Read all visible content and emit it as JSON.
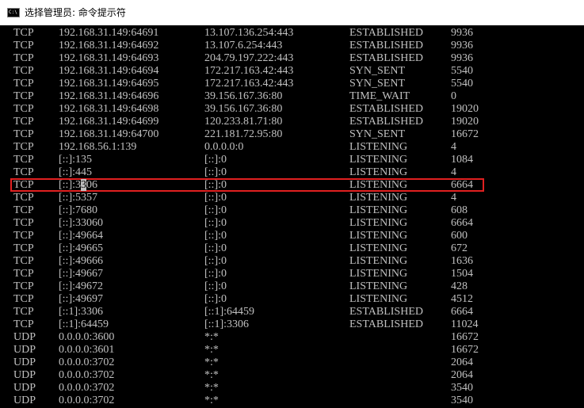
{
  "window": {
    "title": "选择管理员: 命令提示符",
    "icon": "cmd-icon",
    "icon_glyph": "C:\\"
  },
  "colors": {
    "console_bg": "#000000",
    "console_fg": "#c0c0c0",
    "highlight": "#e02020"
  },
  "netstat": {
    "rows": [
      {
        "proto": "TCP",
        "local": "192.168.31.149:64691",
        "foreign": "13.107.136.254:443",
        "state": "ESTABLISHED",
        "pid": "9936"
      },
      {
        "proto": "TCP",
        "local": "192.168.31.149:64692",
        "foreign": "13.107.6.254:443",
        "state": "ESTABLISHED",
        "pid": "9936"
      },
      {
        "proto": "TCP",
        "local": "192.168.31.149:64693",
        "foreign": "204.79.197.222:443",
        "state": "ESTABLISHED",
        "pid": "9936"
      },
      {
        "proto": "TCP",
        "local": "192.168.31.149:64694",
        "foreign": "172.217.163.42:443",
        "state": "SYN_SENT",
        "pid": "5540"
      },
      {
        "proto": "TCP",
        "local": "192.168.31.149:64695",
        "foreign": "172.217.163.42:443",
        "state": "SYN_SENT",
        "pid": "5540"
      },
      {
        "proto": "TCP",
        "local": "192.168.31.149:64696",
        "foreign": "39.156.167.36:80",
        "state": "TIME_WAIT",
        "pid": "0"
      },
      {
        "proto": "TCP",
        "local": "192.168.31.149:64698",
        "foreign": "39.156.167.36:80",
        "state": "ESTABLISHED",
        "pid": "19020"
      },
      {
        "proto": "TCP",
        "local": "192.168.31.149:64699",
        "foreign": "120.233.81.71:80",
        "state": "ESTABLISHED",
        "pid": "19020"
      },
      {
        "proto": "TCP",
        "local": "192.168.31.149:64700",
        "foreign": "221.181.72.95:80",
        "state": "SYN_SENT",
        "pid": "16672"
      },
      {
        "proto": "TCP",
        "local": "192.168.56.1:139",
        "foreign": "0.0.0.0:0",
        "state": "LISTENING",
        "pid": "4"
      },
      {
        "proto": "TCP",
        "local": "[::]:135",
        "foreign": "[::]:0",
        "state": "LISTENING",
        "pid": "1084"
      },
      {
        "proto": "TCP",
        "local": "[::]:445",
        "foreign": "[::]:0",
        "state": "LISTENING",
        "pid": "4"
      },
      {
        "proto": "TCP",
        "local": "[::]:3306",
        "foreign": "[::]:0",
        "state": "LISTENING",
        "pid": "6664",
        "highlighted": true
      },
      {
        "proto": "TCP",
        "local": "[::]:5357",
        "foreign": "[::]:0",
        "state": "LISTENING",
        "pid": "4"
      },
      {
        "proto": "TCP",
        "local": "[::]:7680",
        "foreign": "[::]:0",
        "state": "LISTENING",
        "pid": "608"
      },
      {
        "proto": "TCP",
        "local": "[::]:33060",
        "foreign": "[::]:0",
        "state": "LISTENING",
        "pid": "6664"
      },
      {
        "proto": "TCP",
        "local": "[::]:49664",
        "foreign": "[::]:0",
        "state": "LISTENING",
        "pid": "600"
      },
      {
        "proto": "TCP",
        "local": "[::]:49665",
        "foreign": "[::]:0",
        "state": "LISTENING",
        "pid": "672"
      },
      {
        "proto": "TCP",
        "local": "[::]:49666",
        "foreign": "[::]:0",
        "state": "LISTENING",
        "pid": "1636"
      },
      {
        "proto": "TCP",
        "local": "[::]:49667",
        "foreign": "[::]:0",
        "state": "LISTENING",
        "pid": "1504"
      },
      {
        "proto": "TCP",
        "local": "[::]:49672",
        "foreign": "[::]:0",
        "state": "LISTENING",
        "pid": "428"
      },
      {
        "proto": "TCP",
        "local": "[::]:49697",
        "foreign": "[::]:0",
        "state": "LISTENING",
        "pid": "4512"
      },
      {
        "proto": "TCP",
        "local": "[::1]:3306",
        "foreign": "[::1]:64459",
        "state": "ESTABLISHED",
        "pid": "6664"
      },
      {
        "proto": "TCP",
        "local": "[::1]:64459",
        "foreign": "[::1]:3306",
        "state": "ESTABLISHED",
        "pid": "11024"
      },
      {
        "proto": "UDP",
        "local": "0.0.0.0:3600",
        "foreign": "*:*",
        "state": "",
        "pid": "16672"
      },
      {
        "proto": "UDP",
        "local": "0.0.0.0:3601",
        "foreign": "*:*",
        "state": "",
        "pid": "16672"
      },
      {
        "proto": "UDP",
        "local": "0.0.0.0:3702",
        "foreign": "*:*",
        "state": "",
        "pid": "2064"
      },
      {
        "proto": "UDP",
        "local": "0.0.0.0:3702",
        "foreign": "*:*",
        "state": "",
        "pid": "2064"
      },
      {
        "proto": "UDP",
        "local": "0.0.0.0:3702",
        "foreign": "*:*",
        "state": "",
        "pid": "3540"
      },
      {
        "proto": "UDP",
        "local": "0.0.0.0:3702",
        "foreign": "*:*",
        "state": "",
        "pid": "3540"
      }
    ],
    "highlighted_row": 12,
    "cursor_char_index": 6
  }
}
